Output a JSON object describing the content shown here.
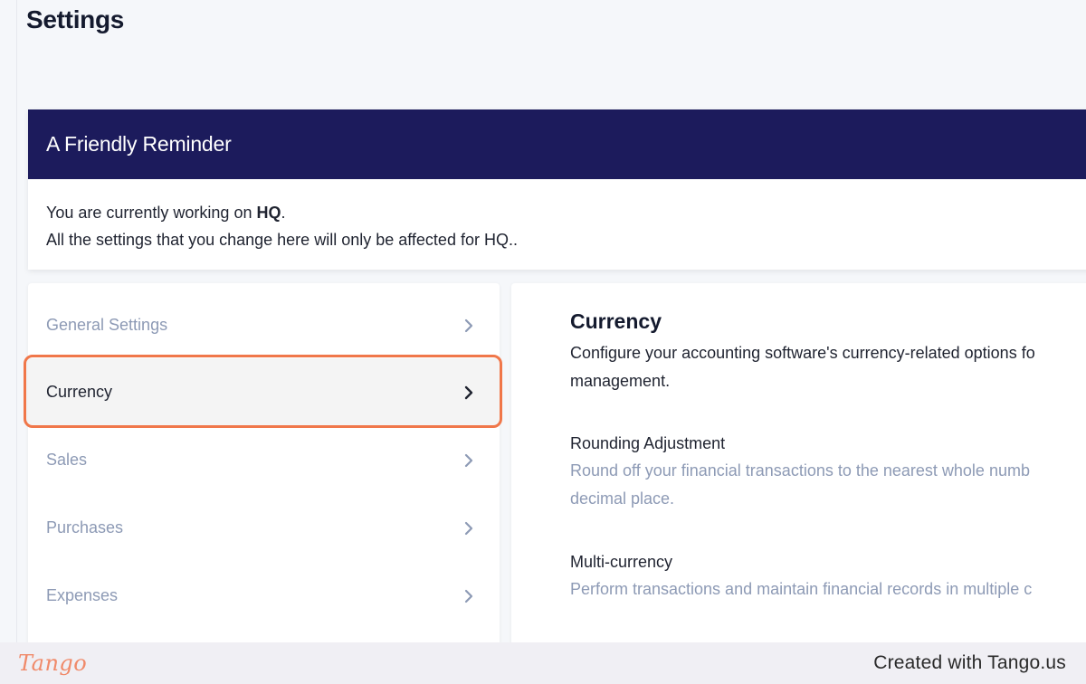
{
  "page": {
    "title": "Settings"
  },
  "reminder": {
    "heading": "A Friendly Reminder",
    "line1_prefix": "You are currently working on ",
    "line1_bold": "HQ",
    "line1_suffix": ".",
    "line2": "All the settings that you change here will only be affected for HQ.."
  },
  "nav": {
    "items": [
      {
        "label": "General Settings",
        "active": false
      },
      {
        "label": "Currency",
        "active": true
      },
      {
        "label": "Sales",
        "active": false
      },
      {
        "label": "Purchases",
        "active": false
      },
      {
        "label": "Expenses",
        "active": false
      }
    ]
  },
  "content": {
    "title": "Currency",
    "desc_line1": "Configure your accounting software's currency-related options fo",
    "desc_line2": "management.",
    "options": [
      {
        "title": "Rounding Adjustment",
        "desc_line1": "Round off your financial transactions to the nearest whole numb",
        "desc_line2": "decimal place."
      },
      {
        "title": "Multi-currency",
        "desc_line1": "Perform transactions and maintain financial records in multiple c"
      }
    ]
  },
  "footer": {
    "logo": "Tango",
    "credit": "Created with Tango.us"
  },
  "colors": {
    "header_bg": "#1c1b5c",
    "highlight": "#f0774a",
    "muted_text": "#8d9ab5"
  },
  "icons": {
    "nav_item": "chevron-right-icon"
  }
}
